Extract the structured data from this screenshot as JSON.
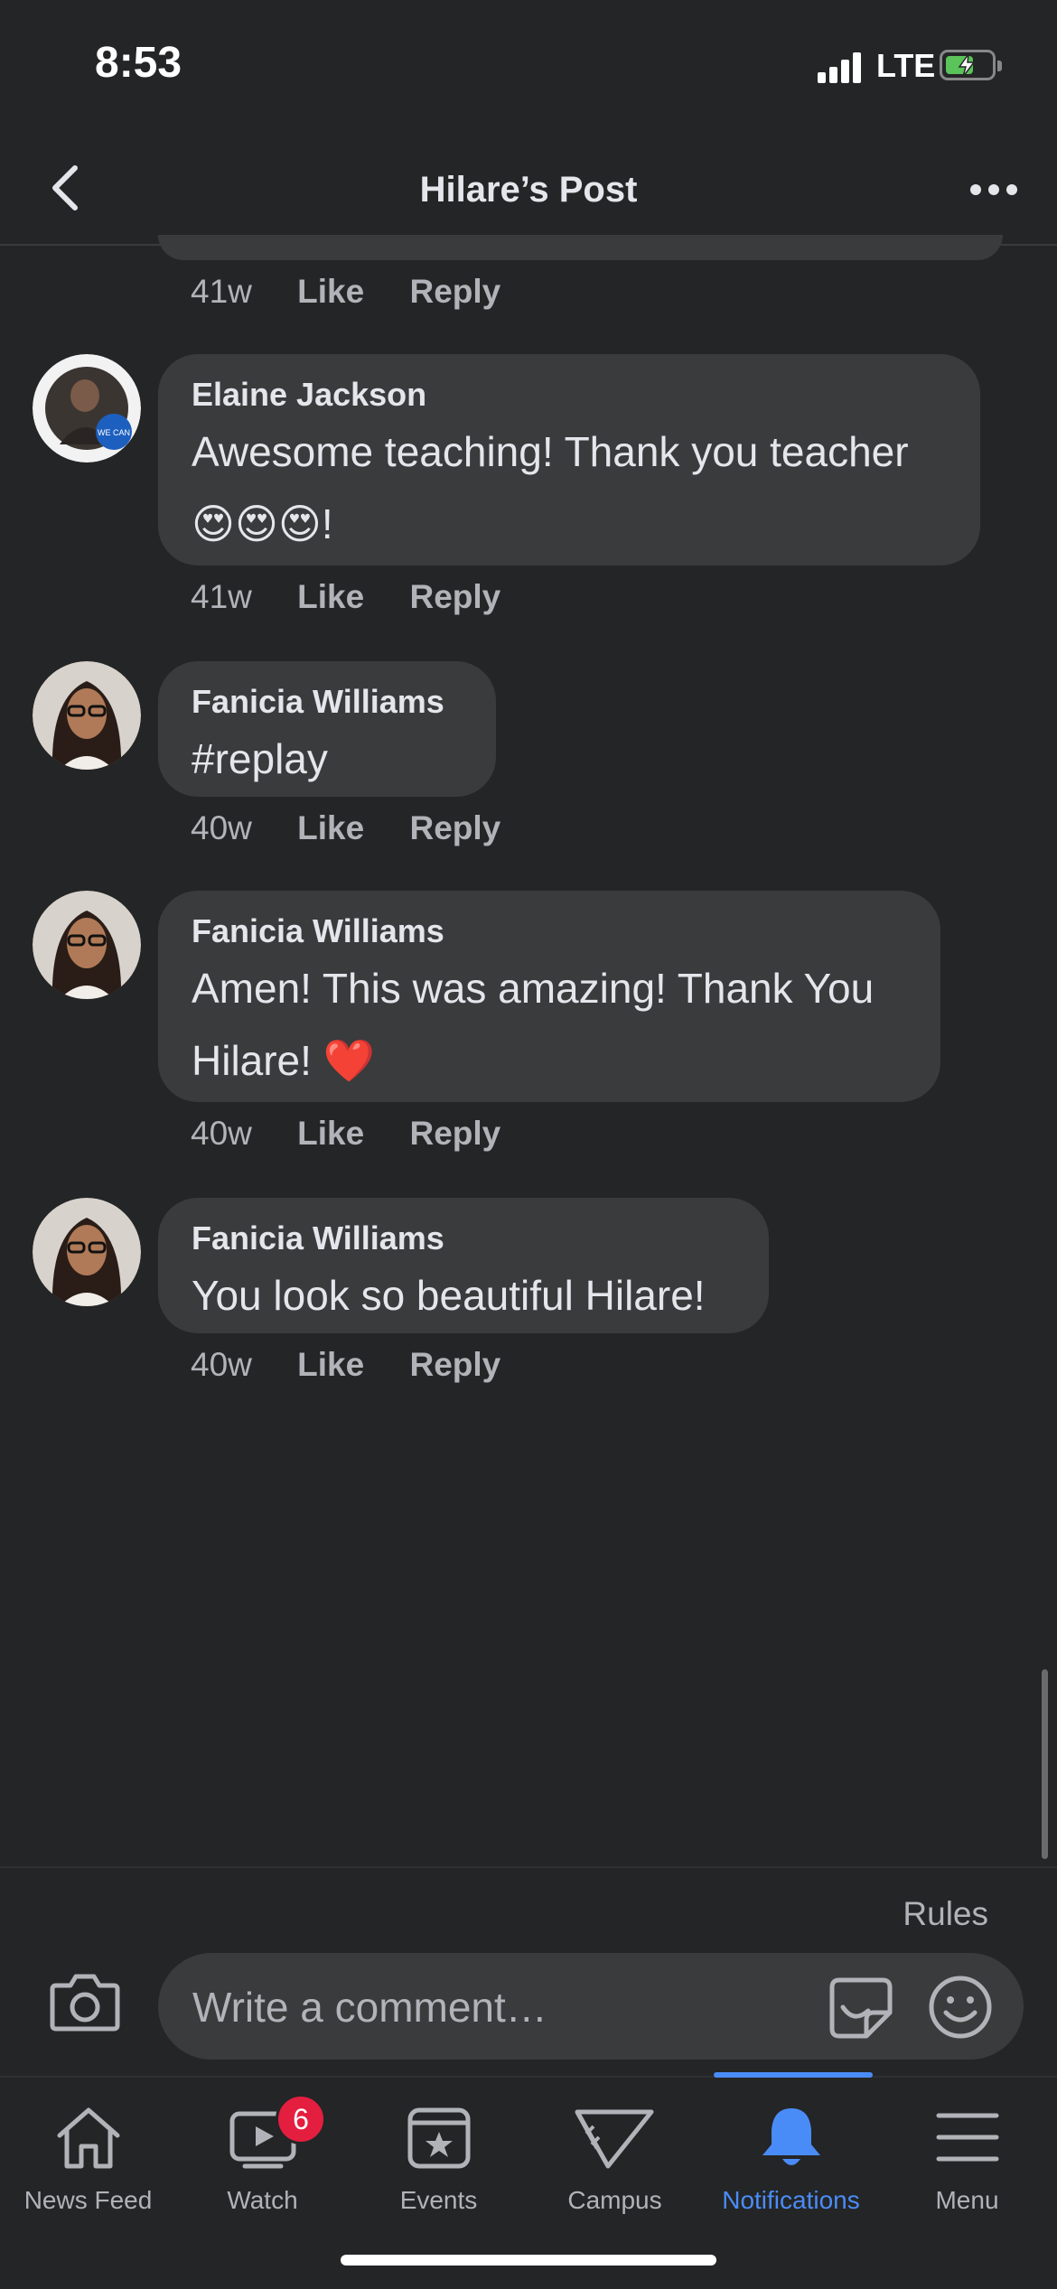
{
  "status": {
    "time": "8:53",
    "network": "LTE"
  },
  "header": {
    "title": "Hilare’s Post"
  },
  "previous_meta": {
    "age": "41w",
    "like": "Like",
    "reply": "Reply"
  },
  "comments": [
    {
      "author": "Elaine Jackson",
      "text": "Awesome teaching! Thank you teacher",
      "text2": "😍😍😍!",
      "age": "41w",
      "like": "Like",
      "reply": "Reply"
    },
    {
      "author": "Fanicia Williams",
      "text": "#replay",
      "age": "40w",
      "like": "Like",
      "reply": "Reply"
    },
    {
      "author": "Fanicia Williams",
      "text": "Amen! This was amazing! Thank You",
      "text2": "Hilare! ❤️",
      "age": "40w",
      "like": "Like",
      "reply": "Reply"
    },
    {
      "author": "Fanicia Williams",
      "text": "You look so beautiful Hilare!",
      "age": "40w",
      "like": "Like",
      "reply": "Reply"
    }
  ],
  "composer": {
    "rules": "Rules",
    "placeholder": "Write a comment…"
  },
  "tabs": [
    {
      "label": "News Feed",
      "icon": "home-icon"
    },
    {
      "label": "Watch",
      "icon": "watch-icon",
      "badge": "6"
    },
    {
      "label": "Events",
      "icon": "events-icon"
    },
    {
      "label": "Campus",
      "icon": "campus-icon"
    },
    {
      "label": "Notifications",
      "icon": "bell-icon",
      "active": true
    },
    {
      "label": "Menu",
      "icon": "menu-icon"
    }
  ],
  "colors": {
    "background": "#242526",
    "bubble": "#3a3b3c",
    "accent": "#4a8cf7",
    "badge": "#e41e3f"
  }
}
